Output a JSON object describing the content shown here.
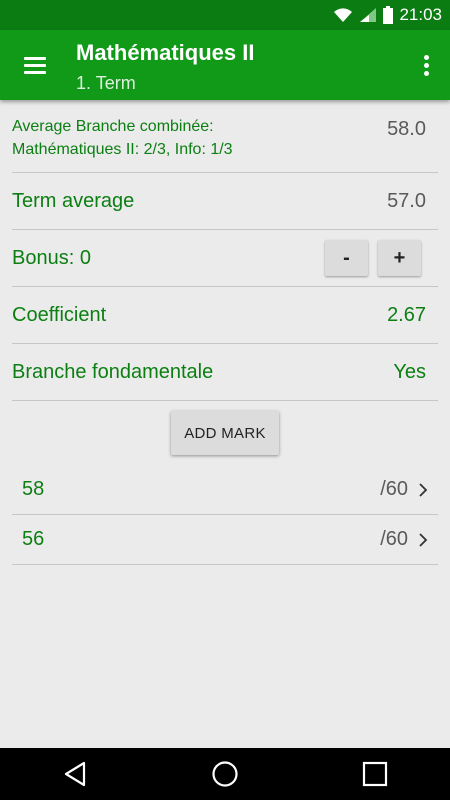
{
  "status_bar": {
    "time": "21:03",
    "icons": [
      "wifi-icon",
      "signal-icon",
      "battery-icon"
    ]
  },
  "app_bar": {
    "title": "Mathématiques II",
    "subtitle": "1. Term",
    "menu_icon": "hamburger-menu-icon",
    "overflow_icon": "more-vertical-icon"
  },
  "average_branch": {
    "label_line1": "Average Branche combinée:",
    "label_line2": "Mathématiques II: 2/3, Info: 1/3",
    "value": "58.0"
  },
  "term_average": {
    "label": "Term average",
    "value": "57.0"
  },
  "bonus": {
    "label": "Bonus: 0",
    "minus_label": "-",
    "plus_label": "+"
  },
  "coefficient": {
    "label": "Coefficient",
    "value": "2.67"
  },
  "branche_fondamentale": {
    "label": "Branche fondamentale",
    "value": "Yes"
  },
  "add_mark_label": "ADD MARK",
  "marks": [
    {
      "score": "58",
      "max": "/60"
    },
    {
      "score": "56",
      "max": "/60"
    }
  ],
  "colors": {
    "status_bar": "#0a7c12",
    "app_bar": "#109a18",
    "accent_text": "#0c7f12",
    "background": "#ebebeb"
  },
  "nav_bar": {
    "icons": [
      "back-icon",
      "home-icon",
      "recents-icon"
    ]
  }
}
